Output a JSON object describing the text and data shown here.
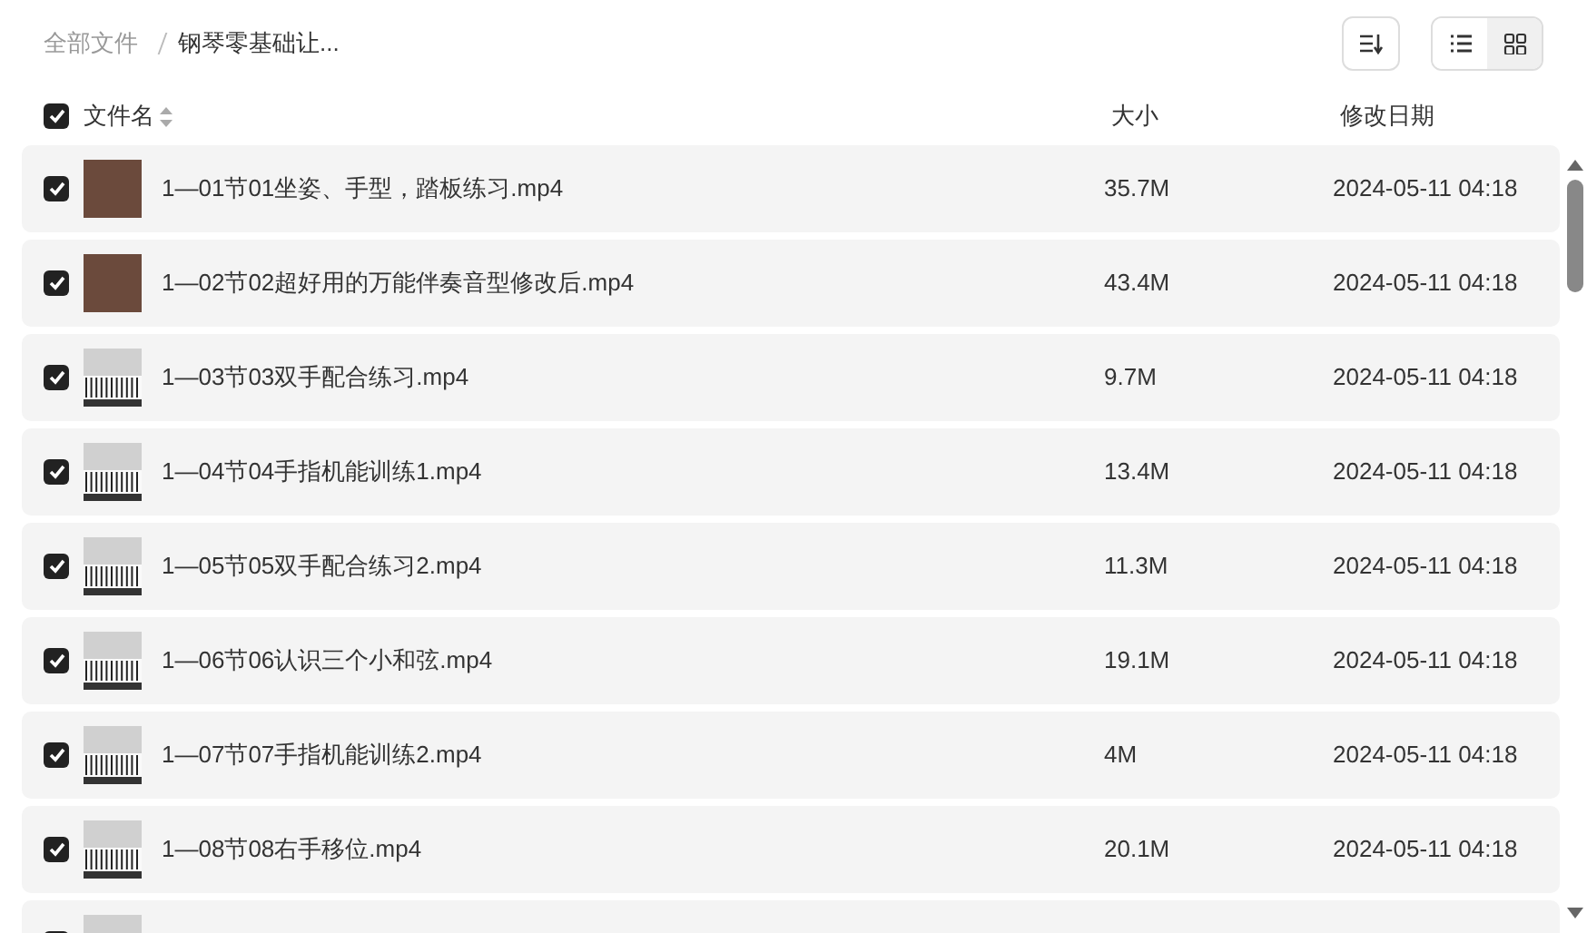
{
  "breadcrumb": [
    {
      "label": "全部文件",
      "current": false
    },
    {
      "label": "钢琴零基础让...",
      "current": true
    }
  ],
  "view_toggle": [
    {
      "kind": "list",
      "selected": false
    },
    {
      "kind": "grid",
      "selected": true
    }
  ],
  "header": {
    "checked": true,
    "columns": [
      "文件名",
      "大小",
      "修改日期"
    ]
  },
  "files": [
    {
      "checked": true,
      "kind": "photo",
      "name": "1—01节01坐姿、手型，踏板练习.mp4",
      "size": "35.7M",
      "modified": "2024-05-11 04:18"
    },
    {
      "checked": true,
      "kind": "photo",
      "name": "1—02节02超好用的万能伴奏音型修改后.mp4",
      "size": "43.4M",
      "modified": "2024-05-11 04:18"
    },
    {
      "checked": true,
      "kind": "keyboard",
      "name": "1—03节03双手配合练习.mp4",
      "size": "9.7M",
      "modified": "2024-05-11 04:18"
    },
    {
      "checked": true,
      "kind": "keyboard",
      "name": "1—04节04手指机能训练1.mp4",
      "size": "13.4M",
      "modified": "2024-05-11 04:18"
    },
    {
      "checked": true,
      "kind": "keyboard",
      "name": "1—05节05双手配合练习2.mp4",
      "size": "11.3M",
      "modified": "2024-05-11 04:18"
    },
    {
      "checked": true,
      "kind": "keyboard",
      "name": "1—06节06认识三个小和弦.mp4",
      "size": "19.1M",
      "modified": "2024-05-11 04:18"
    },
    {
      "checked": true,
      "kind": "keyboard",
      "name": "1—07节07手指机能训练2.mp4",
      "size": "4M",
      "modified": "2024-05-11 04:18"
    },
    {
      "checked": true,
      "kind": "keyboard",
      "name": "1—08节08右手移位.mp4",
      "size": "20.1M",
      "modified": "2024-05-11 04:18"
    },
    {
      "checked": true,
      "kind": "keyboard"
    }
  ]
}
